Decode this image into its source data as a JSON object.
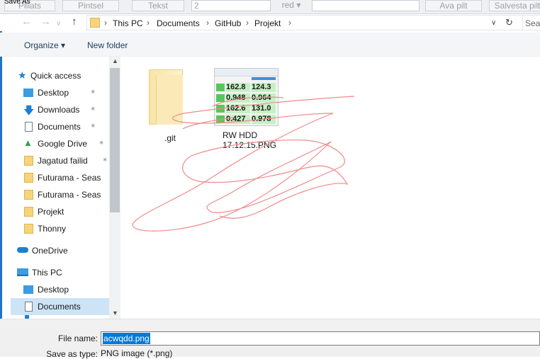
{
  "background_toolbar": {
    "dialog_title": "Save As",
    "buttons": [
      "Pliiats",
      "Pintsel",
      "Tekst",
      "red",
      "Ava pilt",
      "Salvesta pilt"
    ],
    "size_value": "2"
  },
  "address": {
    "crumbs": [
      "This PC",
      "Documents",
      "GitHub",
      "Projekt"
    ],
    "search_placeholder": "Sea"
  },
  "commands": {
    "organize": "Organize ▾",
    "new_folder": "New folder"
  },
  "nav": {
    "items": [
      {
        "label": "Quick access",
        "icon": "star-icon"
      },
      {
        "label": "Desktop",
        "icon": "desktop-icon",
        "pinned": true
      },
      {
        "label": "Downloads",
        "icon": "download-icon",
        "pinned": true
      },
      {
        "label": "Documents",
        "icon": "document-icon",
        "pinned": true
      },
      {
        "label": "Google Drive",
        "icon": "google-drive-icon",
        "pinned": true
      },
      {
        "label": "Jagatud failid",
        "icon": "folder-icon",
        "pinned": true
      },
      {
        "label": "Futurama - Seas",
        "icon": "folder-icon"
      },
      {
        "label": "Futurama - Seas",
        "icon": "folder-icon"
      },
      {
        "label": "Projekt",
        "icon": "folder-icon"
      },
      {
        "label": "Thonny",
        "icon": "folder-icon"
      },
      {
        "label": "OneDrive",
        "icon": "onedrive-icon"
      },
      {
        "label": "This PC",
        "icon": "computer-icon"
      },
      {
        "label": "Desktop",
        "icon": "desktop-icon"
      },
      {
        "label": "Documents",
        "icon": "document-icon",
        "selected": true
      }
    ]
  },
  "files": [
    {
      "name": ".git",
      "type": "folder"
    },
    {
      "name": "RW HDD 17.12.15.PNG",
      "type": "image",
      "thumb_rows": [
        [
          "162.8",
          "124.3"
        ],
        [
          "0.948",
          "0.964"
        ],
        [
          "162.6",
          "131.0"
        ],
        [
          "0.427",
          "0.978"
        ]
      ]
    }
  ],
  "bottom": {
    "file_name_label": "File name:",
    "file_name_value": "acwqdd.png",
    "save_type_label": "Save as type:",
    "save_type_value": "PNG image (*.png)"
  },
  "colors": {
    "selection": "#cde3f6",
    "accent": "#0078d7",
    "scribble": "#f08a8a"
  }
}
